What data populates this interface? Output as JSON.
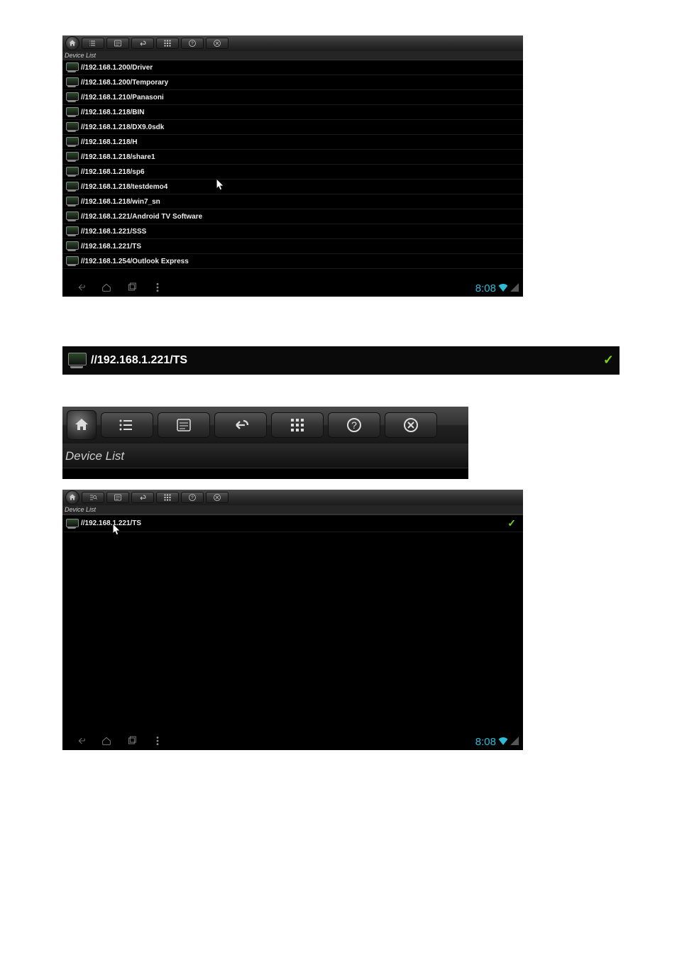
{
  "header_label": "Device List",
  "clock": "8:08",
  "toolbar": {
    "home": "home",
    "list": "list",
    "detail": "detail",
    "back": "back",
    "grid": "grid",
    "help": "help",
    "close": "close",
    "search": "search"
  },
  "ss1": {
    "items": [
      "//192.168.1.200/Driver",
      "//192.168.1.200/Temporary",
      "//192.168.1.210/Panasoni",
      "//192.168.1.218/BIN",
      "//192.168.1.218/DX9.0sdk",
      "//192.168.1.218/H",
      "//192.168.1.218/share1",
      "//192.168.1.218/sp6",
      "//192.168.1.218/testdemo4",
      "//192.168.1.218/win7_sn",
      "//192.168.1.221/Android TV Software",
      "//192.168.1.221/SSS",
      "//192.168.1.221/TS",
      "//192.168.1.254/Outlook Express"
    ]
  },
  "ss2": {
    "item": "//192.168.1.221/TS"
  },
  "ss3": {
    "header_label": "Device List"
  },
  "ss4": {
    "item": "//192.168.1.221/TS"
  }
}
